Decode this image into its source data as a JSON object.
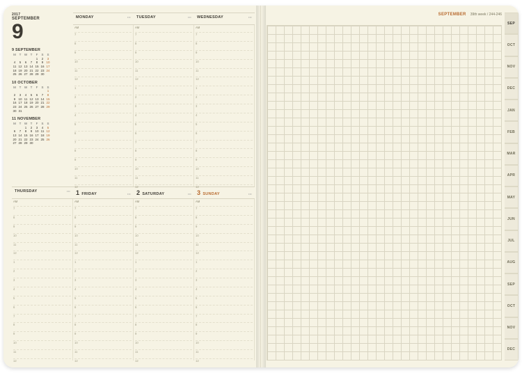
{
  "header": {
    "year": "2017",
    "month_name": "SEPTEMBER",
    "day_num": "9"
  },
  "right_header": {
    "month": "SEPTEMBER",
    "week": "39th week / 244-246"
  },
  "days": {
    "mon": {
      "label": "MONDAY",
      "num": ""
    },
    "tue": {
      "label": "TUESDAY",
      "num": ""
    },
    "wed": {
      "label": "WEDNESDAY",
      "num": ""
    },
    "thu": {
      "label": "THURSDAY",
      "num": ""
    },
    "fri": {
      "label": "FRIDAY",
      "num": "1"
    },
    "sat": {
      "label": "SATURDAY",
      "num": "2"
    },
    "sun": {
      "label": "SUNDAY",
      "num": "3"
    }
  },
  "am_label": "AM",
  "hours": [
    "7",
    "8",
    "9",
    "10",
    "11",
    "12",
    "1",
    "2",
    "3",
    "4",
    "5",
    "6",
    "7",
    "8",
    "9",
    "10",
    "11",
    "12"
  ],
  "minicals": [
    {
      "title": "9 SEPTEMBER",
      "dow": [
        "M",
        "T",
        "W",
        "T",
        "F",
        "S",
        "S"
      ],
      "rows": [
        [
          "",
          "",
          "",
          "",
          "1",
          "2",
          "3"
        ],
        [
          "4",
          "5",
          "6",
          "7",
          "8",
          "9",
          "10"
        ],
        [
          "11",
          "12",
          "13",
          "14",
          "15",
          "16",
          "17"
        ],
        [
          "18",
          "19",
          "20",
          "21",
          "22",
          "23",
          "24"
        ],
        [
          "25",
          "26",
          "27",
          "28",
          "29",
          "30",
          ""
        ]
      ]
    },
    {
      "title": "10 OCTOBER",
      "dow": [
        "M",
        "T",
        "W",
        "T",
        "F",
        "S",
        "S"
      ],
      "rows": [
        [
          "",
          "",
          "",
          "",
          "",
          "",
          "1"
        ],
        [
          "2",
          "3",
          "4",
          "5",
          "6",
          "7",
          "8"
        ],
        [
          "9",
          "10",
          "11",
          "12",
          "13",
          "14",
          "15"
        ],
        [
          "16",
          "17",
          "18",
          "19",
          "20",
          "21",
          "22"
        ],
        [
          "23",
          "24",
          "25",
          "26",
          "27",
          "28",
          "29"
        ],
        [
          "30",
          "31",
          "",
          "",
          "",
          "",
          ""
        ]
      ]
    },
    {
      "title": "11 NOVEMBER",
      "dow": [
        "M",
        "T",
        "W",
        "T",
        "F",
        "S",
        "S"
      ],
      "rows": [
        [
          "",
          "",
          "1",
          "2",
          "3",
          "4",
          "5"
        ],
        [
          "6",
          "7",
          "8",
          "9",
          "10",
          "11",
          "12"
        ],
        [
          "13",
          "14",
          "15",
          "16",
          "17",
          "18",
          "19"
        ],
        [
          "20",
          "21",
          "22",
          "23",
          "24",
          "25",
          "26"
        ],
        [
          "27",
          "28",
          "29",
          "30",
          "",
          "",
          ""
        ]
      ]
    }
  ],
  "tabs": [
    "SEP",
    "OCT",
    "NOV",
    "DEC",
    "JAN",
    "FEB",
    "MAR",
    "APR",
    "MAY",
    "JUN",
    "JUL",
    "AUG",
    "SEP",
    "OCT",
    "NOV",
    "DEC"
  ]
}
